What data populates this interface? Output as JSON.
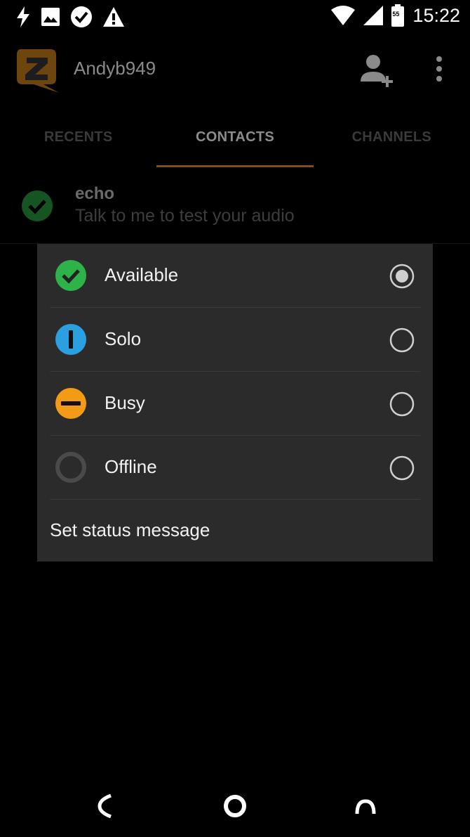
{
  "status_bar": {
    "time": "15:22",
    "battery_level": "55",
    "icons": [
      "flash-icon",
      "image-icon",
      "check-circle-icon",
      "warning-icon",
      "wifi-icon",
      "signal-icon",
      "battery-icon"
    ]
  },
  "app_bar": {
    "username": "Andyb949",
    "logo_letter": "Z",
    "accent_color": "#e29a1c"
  },
  "tabs": [
    {
      "label": "RECENTS",
      "active": false
    },
    {
      "label": "CONTACTS",
      "active": true
    },
    {
      "label": "CHANNELS",
      "active": false
    }
  ],
  "contact": {
    "name": "echo",
    "subtitle": "Talk to me to test your audio",
    "status": "available"
  },
  "status_menu": {
    "options": [
      {
        "label": "Available",
        "color": "#2eb24a",
        "selected": true
      },
      {
        "label": "Solo",
        "color": "#2b9fe0",
        "selected": false
      },
      {
        "label": "Busy",
        "color": "#f39a16",
        "selected": false
      },
      {
        "label": "Offline",
        "color": "#4a4a4a",
        "selected": false
      }
    ],
    "set_message_label": "Set status message"
  },
  "nav_bar": {
    "icons": [
      "back-icon",
      "home-icon",
      "recents-icon"
    ]
  }
}
